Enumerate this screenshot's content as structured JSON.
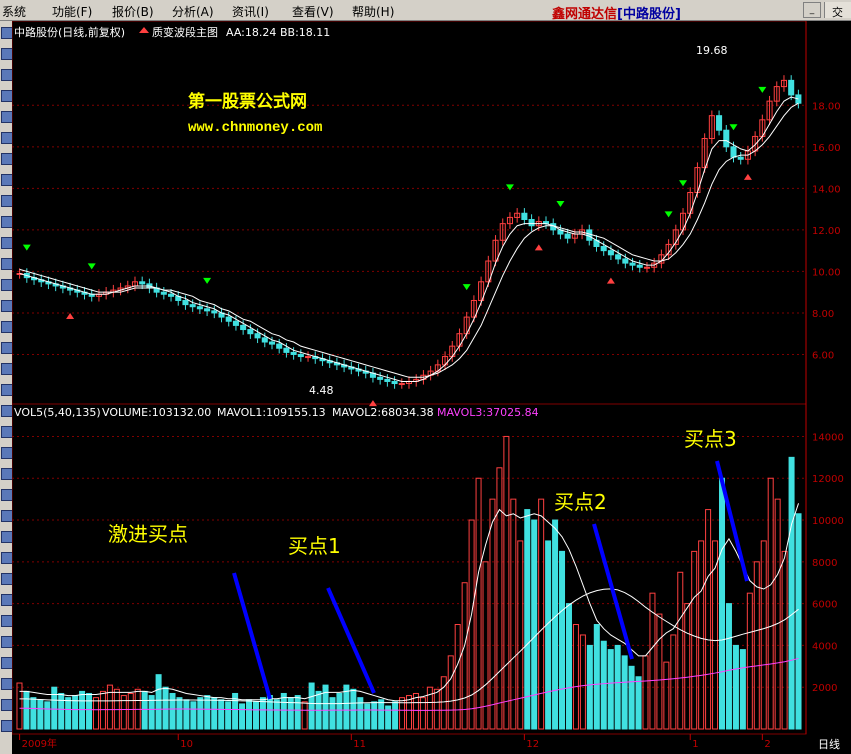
{
  "menu": {
    "items": [
      "系统",
      "功能(F)",
      "报价(B)",
      "分析(A)",
      "资讯(I)",
      "查看(V)",
      "帮助(H)"
    ],
    "brand_main": "鑫网通达信",
    "brand_sub": "[中路股份]",
    "right_tab": "交"
  },
  "header": {
    "stock_title": "中路股份(日线,前复权)",
    "indicator_name": "质变波段主图",
    "aa_label": "AA:18.24",
    "bb_label": "BB:18.11"
  },
  "watermark": {
    "line1": "第一股票公式网",
    "line2": "www.chnmoney.com"
  },
  "volume_header": {
    "vol": "VOL5(5,40,135)",
    "volume": "VOLUME:103132.00",
    "mavol1": "MAVOL1:109155.13",
    "mavol2": "MAVOL2:68034.38",
    "mavol3": "MAVOL3:37025.84"
  },
  "annotations": {
    "aggressive_buy": "激进买点",
    "buy1": "买点1",
    "buy2": "买点2",
    "buy3": "买点3",
    "high_label": "19.68",
    "low_label": "4.48"
  },
  "footer": {
    "period": "日线"
  },
  "colors": {
    "up": "#ff4040",
    "down": "#40e0e0",
    "ma1": "#ffffff",
    "ma2": "#ffffff",
    "ma3": "#ff40ff",
    "grid": "#800000",
    "axis": "#c00000",
    "buy_line": "#0000ff",
    "watermark": "#ffff00",
    "green_arrow": "#00ff00",
    "red_arrow": "#ff4040"
  },
  "chart_data": [
    {
      "type": "candlestick",
      "title": "中路股份(日线,前复权)",
      "yticks": [
        6,
        8,
        10,
        12,
        14,
        16,
        18
      ],
      "ylim": [
        4,
        21
      ],
      "xticks": [
        "2009年",
        "10",
        "11",
        "12",
        "1",
        "2"
      ],
      "high": 19.68,
      "low": 4.48,
      "close": [
        9.9,
        9.7,
        9.6,
        9.5,
        9.4,
        9.3,
        9.2,
        9.1,
        9.0,
        8.9,
        8.8,
        8.9,
        9.0,
        9.1,
        9.2,
        9.3,
        9.5,
        9.4,
        9.2,
        9.0,
        8.9,
        8.8,
        8.6,
        8.4,
        8.3,
        8.2,
        8.1,
        8.0,
        7.8,
        7.6,
        7.4,
        7.2,
        7.0,
        6.8,
        6.6,
        6.5,
        6.3,
        6.1,
        6.0,
        5.9,
        5.9,
        5.8,
        5.7,
        5.6,
        5.5,
        5.4,
        5.3,
        5.2,
        5.1,
        4.9,
        4.8,
        4.7,
        4.6,
        4.6,
        4.7,
        4.8,
        5.0,
        5.2,
        5.5,
        5.9,
        6.4,
        7.0,
        7.8,
        8.6,
        9.5,
        10.5,
        11.5,
        12.3,
        12.6,
        12.8,
        12.5,
        12.2,
        12.4,
        12.3,
        12.0,
        11.8,
        11.6,
        11.8,
        12.0,
        11.5,
        11.2,
        11.0,
        10.8,
        10.6,
        10.4,
        10.3,
        10.2,
        10.2,
        10.4,
        10.8,
        11.3,
        12.0,
        12.8,
        13.8,
        15.0,
        16.4,
        17.5,
        16.8,
        16.0,
        15.5,
        15.4,
        15.8,
        16.5,
        17.3,
        18.2,
        18.9,
        19.2,
        18.5,
        18.1
      ],
      "ma_short": [
        9.9,
        9.8,
        9.7,
        9.6,
        9.5,
        9.4,
        9.3,
        9.2,
        9.1,
        9.0,
        8.9,
        8.9,
        8.9,
        9.0,
        9.1,
        9.2,
        9.3,
        9.3,
        9.3,
        9.2,
        9.1,
        9.0,
        8.8,
        8.7,
        8.5,
        8.4,
        8.3,
        8.2,
        8.0,
        7.9,
        7.7,
        7.5,
        7.3,
        7.1,
        6.9,
        6.7,
        6.6,
        6.4,
        6.2,
        6.1,
        6.0,
        5.9,
        5.8,
        5.7,
        5.6,
        5.5,
        5.4,
        5.3,
        5.2,
        5.1,
        5.0,
        4.9,
        4.8,
        4.7,
        4.7,
        4.7,
        4.8,
        5.0,
        5.2,
        5.5,
        5.9,
        6.4,
        7.0,
        7.7,
        8.5,
        9.4,
        10.4,
        11.2,
        11.8,
        12.2,
        12.3,
        12.3,
        12.3,
        12.3,
        12.2,
        12.0,
        11.9,
        11.8,
        11.8,
        11.7,
        11.5,
        11.3,
        11.1,
        10.9,
        10.7,
        10.5,
        10.4,
        10.3,
        10.3,
        10.5,
        10.9,
        11.4,
        12.0,
        12.8,
        13.8,
        14.9,
        15.9,
        16.3,
        16.3,
        16.1,
        15.9,
        15.8,
        16.1,
        16.5,
        17.1,
        17.7,
        18.2,
        18.4,
        18.3
      ],
      "ma_long": [
        10.1,
        10.0,
        9.9,
        9.8,
        9.7,
        9.6,
        9.5,
        9.4,
        9.3,
        9.2,
        9.1,
        9.0,
        9.0,
        9.0,
        9.0,
        9.1,
        9.2,
        9.2,
        9.2,
        9.2,
        9.1,
        9.1,
        9.0,
        8.9,
        8.8,
        8.6,
        8.5,
        8.4,
        8.2,
        8.1,
        7.9,
        7.7,
        7.6,
        7.4,
        7.2,
        7.0,
        6.9,
        6.7,
        6.6,
        6.4,
        6.3,
        6.2,
        6.1,
        6.0,
        5.9,
        5.8,
        5.7,
        5.6,
        5.5,
        5.4,
        5.3,
        5.2,
        5.1,
        5.0,
        4.9,
        4.9,
        4.9,
        5.0,
        5.1,
        5.3,
        5.5,
        5.8,
        6.2,
        6.8,
        7.4,
        8.2,
        9.0,
        9.8,
        10.5,
        11.1,
        11.6,
        11.9,
        12.1,
        12.2,
        12.2,
        12.1,
        12.0,
        11.9,
        11.9,
        11.8,
        11.7,
        11.6,
        11.4,
        11.2,
        11.0,
        10.8,
        10.7,
        10.6,
        10.5,
        10.5,
        10.6,
        10.9,
        11.3,
        11.8,
        12.5,
        13.3,
        14.2,
        14.9,
        15.3,
        15.5,
        15.6,
        15.6,
        15.8,
        16.1,
        16.5,
        17.0,
        17.5,
        17.9,
        18.1
      ]
    },
    {
      "type": "bar",
      "title": "VOL5(5,40,135)",
      "yticks": [
        2000,
        4000,
        6000,
        8000,
        10000,
        12000,
        14000
      ],
      "ylim": [
        0,
        14500
      ],
      "values": [
        2200,
        1800,
        1500,
        1400,
        1300,
        2000,
        1700,
        1500,
        1600,
        1800,
        1700,
        1500,
        1800,
        2100,
        1900,
        1600,
        1700,
        1900,
        1800,
        1600,
        2600,
        2000,
        1700,
        1500,
        1400,
        1300,
        1500,
        1600,
        1500,
        1400,
        1300,
        1700,
        1200,
        1400,
        1300,
        1500,
        1600,
        1400,
        1700,
        1500,
        1600,
        1300,
        2200,
        1800,
        2100,
        1500,
        1700,
        2100,
        1900,
        1500,
        1200,
        1300,
        1400,
        1100,
        1300,
        1500,
        1600,
        1700,
        1500,
        2000,
        1900,
        2500,
        3500,
        5000,
        7000,
        10000,
        12000,
        8000,
        11000,
        12500,
        14000,
        11000,
        9000,
        10500,
        10000,
        11000,
        9000,
        10000,
        8500,
        6000,
        5000,
        4500,
        4000,
        5000,
        4200,
        3800,
        4000,
        3500,
        3000,
        2500,
        3500,
        6500,
        5500,
        3200,
        4500,
        7500,
        6000,
        8500,
        9000,
        10500,
        9000,
        12000,
        6000,
        4000,
        3800,
        6500,
        8000,
        9000,
        12000,
        11000,
        8500,
        13000,
        10300
      ],
      "mavol1": [
        1800,
        1800,
        1750,
        1700,
        1650,
        1650,
        1650,
        1600,
        1600,
        1650,
        1650,
        1650,
        1700,
        1750,
        1750,
        1750,
        1750,
        1800,
        1800,
        1750,
        1900,
        1950,
        1900,
        1800,
        1700,
        1650,
        1600,
        1550,
        1500,
        1500,
        1450,
        1450,
        1400,
        1400,
        1400,
        1400,
        1450,
        1450,
        1500,
        1500,
        1500,
        1450,
        1550,
        1650,
        1750,
        1750,
        1750,
        1800,
        1850,
        1800,
        1700,
        1600,
        1500,
        1400,
        1350,
        1350,
        1400,
        1500,
        1550,
        1650,
        1750,
        2000,
        2400,
        3100,
        4000,
        5500,
        7500,
        8800,
        9900,
        10500,
        10200,
        10300,
        10100,
        10200,
        10300,
        10200,
        9900,
        9600,
        9200,
        8600,
        7800,
        6900,
        6000,
        5200,
        4800,
        4500,
        4300,
        4100,
        3800,
        3500,
        3500,
        3900,
        4300,
        4600,
        4800,
        5300,
        5800,
        6300,
        6600,
        7300,
        7700,
        8600,
        9100,
        8500,
        7800,
        7100,
        6800,
        6700,
        6900,
        7400,
        8200,
        9800,
        10800
      ]
    }
  ]
}
